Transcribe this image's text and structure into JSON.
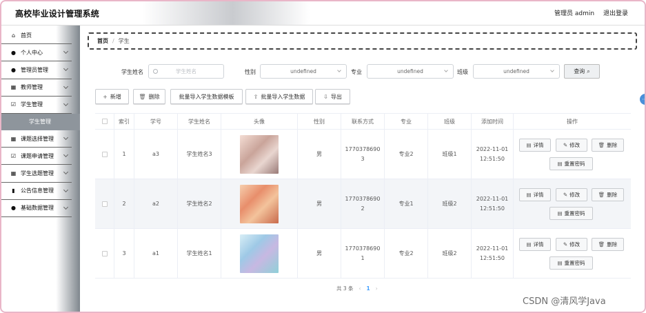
{
  "app": {
    "title": "高校毕业设计管理系统"
  },
  "header": {
    "user_role_label": "管理员 admin",
    "logout_label": "退出登录"
  },
  "sidebar": {
    "items": [
      {
        "label": "首页",
        "icon": "home-icon",
        "has_arrow": false
      },
      {
        "label": "个人中心",
        "icon": "user-icon",
        "has_arrow": true
      },
      {
        "label": "管理员管理",
        "icon": "admin-icon",
        "has_arrow": true
      },
      {
        "label": "教师管理",
        "icon": "grid-icon",
        "has_arrow": true
      },
      {
        "label": "学生管理",
        "icon": "checkbox-icon",
        "has_arrow": true
      }
    ],
    "active_sub": {
      "label": "学生管理"
    },
    "items_after": [
      {
        "label": "课题选择管理",
        "icon": "grid-icon",
        "has_arrow": true
      },
      {
        "label": "课题申请管理",
        "icon": "checkbox-icon",
        "has_arrow": true
      },
      {
        "label": "学生选题管理",
        "icon": "grid-icon",
        "has_arrow": true
      },
      {
        "label": "公告信息管理",
        "icon": "chart-icon",
        "has_arrow": true
      },
      {
        "label": "基础数据管理",
        "icon": "location-pin-icon",
        "has_arrow": true
      }
    ]
  },
  "breadcrumb": {
    "home": "首页",
    "separator": "/",
    "current": "学生"
  },
  "search": {
    "name_label": "学生姓名",
    "name_placeholder": "学生姓名",
    "gender_label": "性别",
    "gender_value": "undefined",
    "major_label": "专业",
    "major_value": "undefined",
    "class_label": "班级",
    "class_value": "undefined",
    "query_label": "查询"
  },
  "toolbar": {
    "add_label": "新增",
    "delete_label": "删除",
    "import_template_label": "批量导入学生数据模板",
    "import_data_label": "批量导入学生数据",
    "export_label": "导出"
  },
  "table": {
    "headers": {
      "index": "索引",
      "student_no": "学号",
      "student_name": "学生姓名",
      "avatar": "头像",
      "gender": "性别",
      "phone": "联系方式",
      "major": "专业",
      "class": "班级",
      "added_time": "添加时间",
      "actions": "操作"
    },
    "rows": [
      {
        "index": "1",
        "student_no": "a3",
        "student_name": "学生姓名3",
        "gender": "男",
        "phone_l1": "1770378690",
        "phone_l2": "3",
        "major": "专业2",
        "class": "班级1",
        "date": "2022-11-01",
        "time": "12:51:50"
      },
      {
        "index": "2",
        "student_no": "a2",
        "student_name": "学生姓名2",
        "gender": "男",
        "phone_l1": "1770378690",
        "phone_l2": "2",
        "major": "专业1",
        "class": "班级2",
        "date": "2022-11-01",
        "time": "12:51:50"
      },
      {
        "index": "3",
        "student_no": "a1",
        "student_name": "学生姓名1",
        "gender": "男",
        "phone_l1": "1770378690",
        "phone_l2": "1",
        "major": "专业2",
        "class": "班级2",
        "date": "2022-11-01",
        "time": "12:51:50"
      }
    ],
    "actions": {
      "detail": "详情",
      "edit": "修改",
      "delete": "删除",
      "reset_password": "重置密码"
    }
  },
  "pagination": {
    "total_label": "共 3 条",
    "prev": "‹",
    "current_page": "1",
    "next": "›"
  },
  "watermark": "CSDN @清风学Java",
  "colors": {
    "accent": "#409eff",
    "sidebar_active": "#8e959c",
    "frame": "#e9b6c8"
  }
}
